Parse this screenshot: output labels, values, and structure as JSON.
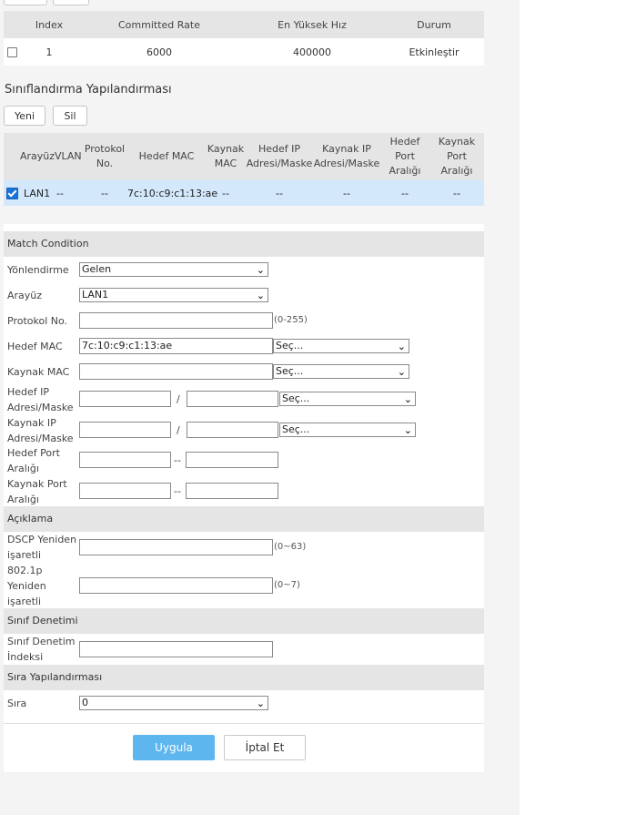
{
  "rate_table": {
    "headers": [
      "Index",
      "Committed Rate",
      "En Yüksek Hız",
      "Durum"
    ],
    "rows": [
      {
        "index": "1",
        "committed": "6000",
        "max": "400000",
        "status": "Etkinleştir"
      }
    ]
  },
  "class_section": {
    "title": "Sınıflandırma Yapılandırması",
    "new_label": "Yeni",
    "delete_label": "Sil"
  },
  "class_table": {
    "headers": {
      "iface": "Arayüz",
      "vlan": "VLAN",
      "proto": [
        "Protokol",
        "No."
      ],
      "dmac": "Hedef MAC",
      "smac": [
        "Kaynak",
        "MAC"
      ],
      "dip": [
        "Hedef IP",
        "Adresi/Maske"
      ],
      "sip": [
        "Kaynak IP",
        "Adresi/Maske"
      ],
      "dport": [
        "Hedef",
        "Port",
        "Aralığı"
      ],
      "sport": [
        "Kaynak",
        "Port",
        "Aralığı"
      ]
    },
    "rows": [
      {
        "iface": "LAN1",
        "vlan": "--",
        "proto": "--",
        "dmac": "7c:10:c9:c1:13:ae",
        "smac": "--",
        "dip": "--",
        "sip": "--",
        "dport": "--",
        "sport": "--"
      }
    ]
  },
  "form": {
    "match_title": "Match Condition",
    "direction": {
      "label": "Yönlendirme",
      "value": "Gelen"
    },
    "iface": {
      "label": "Arayüz",
      "value": "LAN1"
    },
    "proto": {
      "label": "Protokol No.",
      "value": "",
      "hint": "(0-255)"
    },
    "dmac": {
      "label": "Hedef MAC",
      "value": "7c:10:c9:c1:13:ae",
      "select": "Seç..."
    },
    "smac": {
      "label": "Kaynak MAC",
      "value": "",
      "select": "Seç..."
    },
    "dip": {
      "label": [
        "Hedef IP",
        "Adresi/Maske"
      ],
      "sep": "/",
      "select": "Seç..."
    },
    "sip": {
      "label": [
        "Kaynak IP",
        "Adresi/Maske"
      ],
      "sep": "/",
      "select": "Seç..."
    },
    "dport": {
      "label": [
        "Hedef Port",
        "Aralığı"
      ],
      "sep": "--"
    },
    "sport": {
      "label": [
        "Kaynak Port",
        "Aralığı"
      ],
      "sep": "--"
    },
    "desc_title": "Açıklama",
    "dscp": {
      "label": [
        "DSCP Yeniden",
        "işaretli"
      ],
      "hint": "(0~63)"
    },
    "p8021": {
      "label": [
        "802.1p",
        "Yeniden",
        "işaretli"
      ],
      "hint": "(0~7)"
    },
    "classctl_title": "Sınıf Denetimi",
    "classctl": {
      "label": [
        "Sınıf Denetim",
        "İndeksi"
      ]
    },
    "queue_title": "Sıra Yapılandırması",
    "queue": {
      "label": "Sıra",
      "value": "0"
    },
    "apply_label": "Uygula",
    "cancel_label": "İptal Et"
  },
  "colors": {
    "accent": "#5eb6ee",
    "selected_row": "#d3e8fb",
    "header_bg": "#e5e5e5"
  }
}
